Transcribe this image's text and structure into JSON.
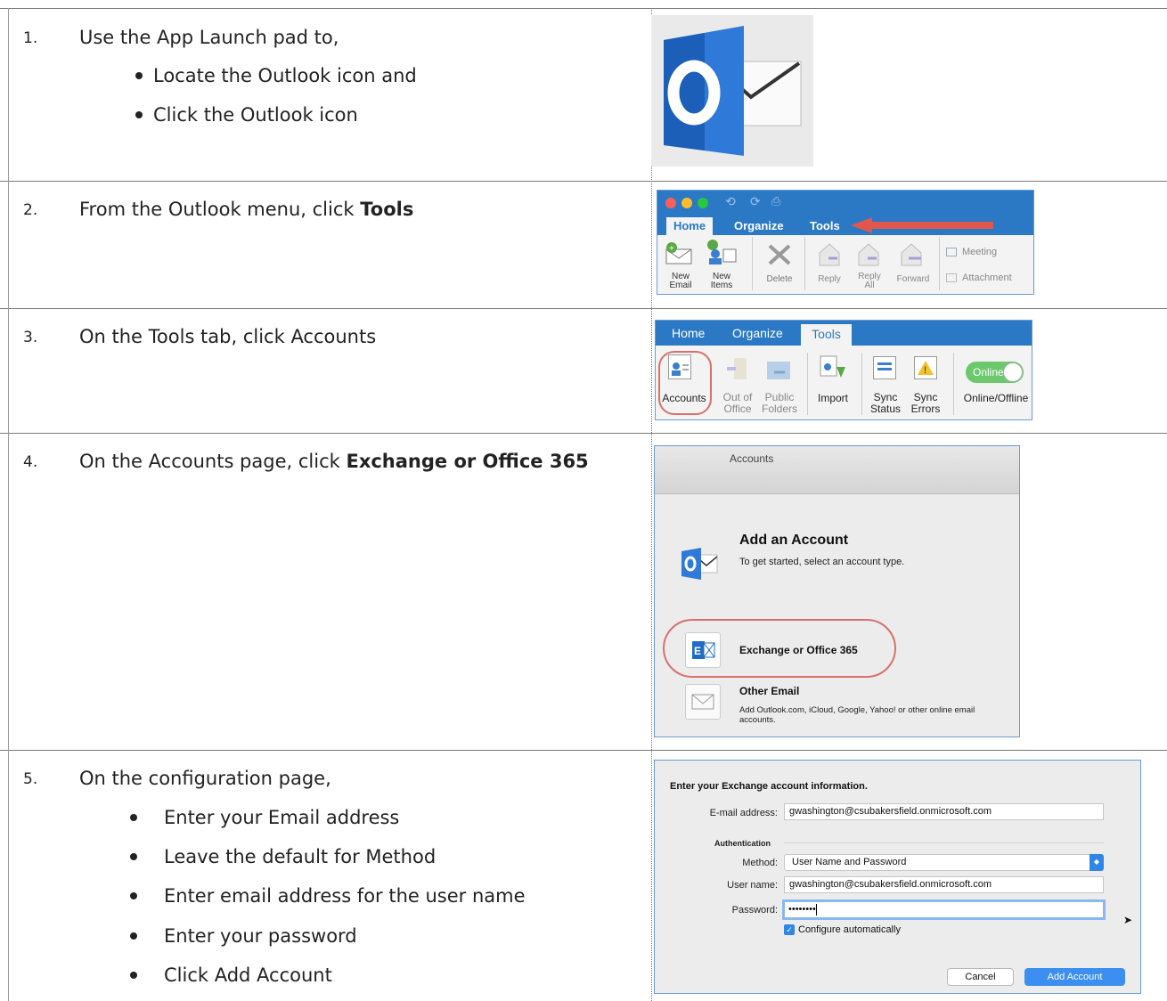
{
  "steps": [
    {
      "number": "1.",
      "text": "Use the App Launch pad to,",
      "bullets": [
        "Locate the Outlook icon and",
        "Click the Outlook icon"
      ]
    },
    {
      "number": "2.",
      "text_prefix": "From the Outlook menu, click ",
      "text_bold": "Tools"
    },
    {
      "number": "3.",
      "text": "On the Tools tab, click Accounts"
    },
    {
      "number": "4.",
      "text_prefix": "On the Accounts page, click ",
      "text_bold": "Exchange or Office 365"
    },
    {
      "number": "5.",
      "text": "On the configuration page,",
      "bullets": [
        "Enter your Email address",
        "Leave the default for Method",
        "Enter email address for the user name",
        "Enter your password",
        "Click Add Account"
      ]
    }
  ],
  "outlook_icon": {
    "letter": "O",
    "name": "outlook-icon"
  },
  "ribbon1": {
    "tabs": [
      "Home",
      "Organize",
      "Tools"
    ],
    "buttons": [
      {
        "label": "New\nEmail"
      },
      {
        "label": "New\nItems"
      },
      {
        "label": "Delete"
      },
      {
        "label": "Reply"
      },
      {
        "label": "Reply\nAll"
      },
      {
        "label": "Forward"
      }
    ],
    "side": [
      "Meeting",
      "Attachment"
    ],
    "arrow_color": "#e2574c"
  },
  "ribbon2": {
    "tabs": [
      "Home",
      "Organize",
      "Tools"
    ],
    "buttons": [
      {
        "label": "Accounts"
      },
      {
        "label": "Out of\nOffice"
      },
      {
        "label": "Public\nFolders"
      },
      {
        "label": "Import"
      },
      {
        "label": "Sync\nStatus"
      },
      {
        "label": "Sync\nErrors"
      },
      {
        "label": "Online/Offline"
      }
    ],
    "toggle": "Online"
  },
  "accounts_dialog": {
    "title": "Accounts",
    "heading": "Add an Account",
    "subheading": "To get started, select an account type.",
    "option1": "Exchange or Office 365",
    "option2_title": "Other Email",
    "option2_desc": "Add Outlook.com, iCloud, Google, Yahoo! or other online email accounts."
  },
  "config_dialog": {
    "heading": "Enter your Exchange account information.",
    "email_label": "E-mail address:",
    "email_value": "gwashington@csubakersfield.onmicrosoft.com",
    "auth_label": "Authentication",
    "method_label": "Method:",
    "method_value": "User Name and Password",
    "username_label": "User name:",
    "username_value": "gwashington@csubakersfield.onmicrosoft.com",
    "password_label": "Password:",
    "password_value": "••••••••",
    "checkbox_label": "Configure automatically",
    "cancel": "Cancel",
    "add": "Add Account"
  },
  "colors": {
    "accent": "#1f6cc2",
    "ribbon_tab_bar": "#2b79c5",
    "highlight_circle": "#d9706a"
  }
}
